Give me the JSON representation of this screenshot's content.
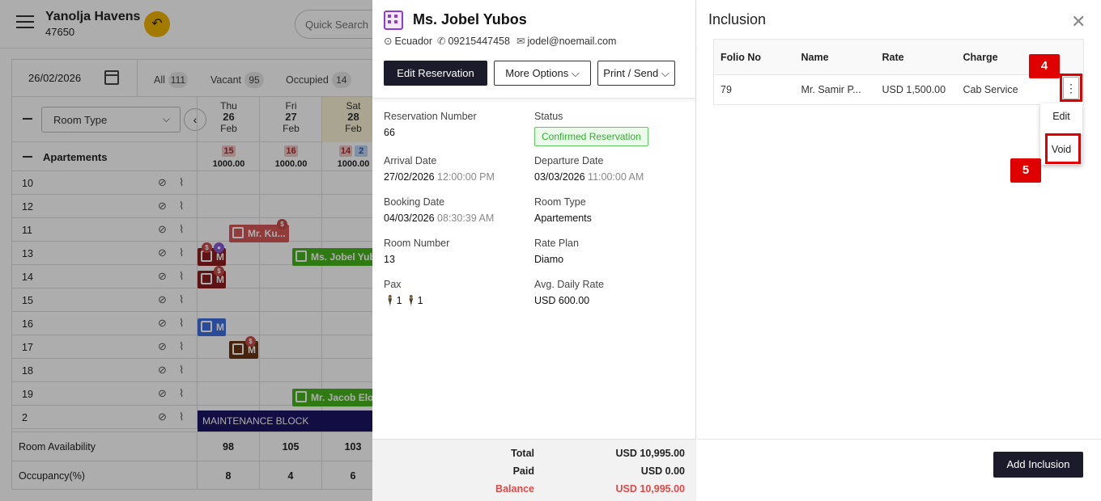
{
  "app": {
    "hotel_name": "Yanolja Havens",
    "hotel_id": "47650",
    "quick_search_placeholder": "Quick Search"
  },
  "calendar": {
    "date": "26/02/2026",
    "filters": [
      {
        "label": "All",
        "count": "111"
      },
      {
        "label": "Vacant",
        "count": "95"
      },
      {
        "label": "Occupied",
        "count": "14"
      }
    ],
    "room_type_select": "Room Type",
    "days": [
      {
        "dow": "Thu",
        "day": "26",
        "month": "Feb"
      },
      {
        "dow": "Fri",
        "day": "27",
        "month": "Feb"
      },
      {
        "dow": "Sat",
        "day": "28",
        "month": "Feb"
      }
    ],
    "group": {
      "name": "Apartements",
      "cells": [
        {
          "badges": [
            "15"
          ],
          "price": "1000.00"
        },
        {
          "badges": [
            "16"
          ],
          "price": "1000.00"
        },
        {
          "badges": [
            "14",
            "2"
          ],
          "price": "1000.00"
        }
      ]
    },
    "rooms": [
      "10",
      "12",
      "11",
      "13",
      "14",
      "15",
      "16",
      "17",
      "18",
      "19",
      "2"
    ],
    "bookings": {
      "mr_ku": "Mr. Ku...",
      "jobel": "Ms. Jobel Yubo",
      "m14": "M",
      "m13": "M",
      "m16": "M",
      "m17": "M",
      "jacob": "Mr. Jacob Elo",
      "maintenance": "MAINTENANCE BLOCK"
    },
    "footer": {
      "availability_label": "Room Availability",
      "availability": [
        "98",
        "105",
        "103"
      ],
      "occupancy_label": "Occupancy(%)",
      "occupancy": [
        "8",
        "4",
        "6"
      ]
    },
    "colors": {
      "confirmed_bar": "#47b41c",
      "red_bar": "#d75757",
      "blue_bar": "#3f6fe0",
      "brown_bar": "#6b3412",
      "maintenance": "#1b1464"
    }
  },
  "reservation": {
    "guest_name": "Ms. Jobel Yubos",
    "country": "Ecuador",
    "phone": "09215447458",
    "email": "jodel@noemail.com",
    "buttons": {
      "edit": "Edit Reservation",
      "more": "More Options",
      "print": "Print / Send"
    },
    "fields": {
      "reservation_number_label": "Reservation Number",
      "reservation_number": "66",
      "status_label": "Status",
      "status": "Confirmed Reservation",
      "arrival_label": "Arrival Date",
      "arrival_date": "27/02/2026",
      "arrival_time": "12:00:00 PM",
      "departure_label": "Departure Date",
      "departure_date": "03/03/2026",
      "departure_time": "11:00:00 AM",
      "booking_label": "Booking Date",
      "booking_date": "04/03/2026",
      "booking_time": "08:30:39 AM",
      "room_type_label": "Room Type",
      "room_type": "Apartements",
      "room_number_label": "Room Number",
      "room_number": "13",
      "rate_plan_label": "Rate Plan",
      "rate_plan": "Diamo",
      "pax_label": "Pax",
      "pax_adults": "1",
      "pax_children": "1",
      "adr_label": "Avg. Daily Rate",
      "adr": "USD 600.00"
    },
    "totals": {
      "total_label": "Total",
      "total": "USD 10,995.00",
      "paid_label": "Paid",
      "paid": "USD 0.00",
      "balance_label": "Balance",
      "balance": "USD 10,995.00"
    }
  },
  "inclusion": {
    "title": "Inclusion",
    "columns": [
      "Folio No",
      "Name",
      "Rate",
      "Charge"
    ],
    "rows": [
      {
        "folio": "79",
        "name": "Mr. Samir P...",
        "rate": "USD 1,500.00",
        "charge": "Cab Service"
      }
    ],
    "menu": {
      "edit": "Edit",
      "void": "Void"
    },
    "markers": {
      "kebab": "4",
      "void": "5"
    },
    "add_button": "Add Inclusion"
  }
}
